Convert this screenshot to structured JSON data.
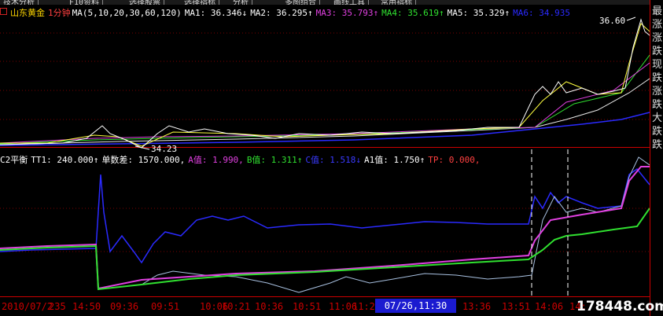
{
  "toolbar": [
    "技术分析",
    "F10资料",
    "选择股票",
    "选择指标",
    "分析",
    "多图组合",
    "画线工具",
    "常用指标"
  ],
  "upper_panel": {
    "symbol": "山东黄金",
    "period": "1分钟",
    "ma_label": "MA(5,10,20,30,60,120)",
    "ma_values": [
      {
        "label": "MA1:",
        "value": "36.346",
        "arrow": "↓",
        "color": "#ffffff"
      },
      {
        "label": "MA2:",
        "value": "36.295",
        "arrow": "↑",
        "color": "#ffffff"
      },
      {
        "label": "MA3:",
        "value": "35.793",
        "arrow": "↑",
        "color": "#e040e0"
      },
      {
        "label": "MA4:",
        "value": "35.619",
        "arrow": "↑",
        "color": "#30e030"
      },
      {
        "label": "MA5:",
        "value": "35.329",
        "arrow": "↑",
        "color": "#ffffff"
      },
      {
        "label": "MA6:",
        "value": "34.935",
        "arrow": "",
        "color": "#2a2aff"
      }
    ],
    "high_label": "36.60",
    "low_label": "34.23"
  },
  "lower_panel": {
    "name": "C2平衡",
    "items": [
      {
        "label": "TT1:",
        "value": "240.000",
        "arrow": "↑",
        "color": "#ffffff"
      },
      {
        "label": "单数差:",
        "value": "1570.000,",
        "arrow": "",
        "color": "#ffffff"
      },
      {
        "label": "A值:",
        "value": "1.990,",
        "arrow": "",
        "color": "#e040e0"
      },
      {
        "label": "B值:",
        "value": "1.311",
        "arrow": "↑",
        "color": "#30e030"
      },
      {
        "label": "C值:",
        "value": "1.518",
        "arrow": "↓",
        "color": "#3a3aff"
      },
      {
        "label": "A1值:",
        "value": "1.750",
        "arrow": "↑",
        "color": "#ffffff"
      },
      {
        "label": "TP:",
        "value": "0.000,",
        "arrow": "",
        "color": "#ff4040"
      }
    ]
  },
  "time_axis": [
    "2010/07/2",
    "235",
    "14:50",
    "09:36",
    "09:51",
    "10:06",
    "10:21",
    "10:36",
    "10:51",
    "11:06",
    "11:2",
    "13:36",
    "13:51",
    "14:06",
    "14:"
  ],
  "crosshair_time": "07/26,11:30",
  "right_tabs": [
    "最",
    "涨",
    "涨",
    "跌",
    "现",
    "跌",
    "涨",
    "跌",
    "大",
    "跌",
    "跌"
  ],
  "watermark": "178448.com"
}
